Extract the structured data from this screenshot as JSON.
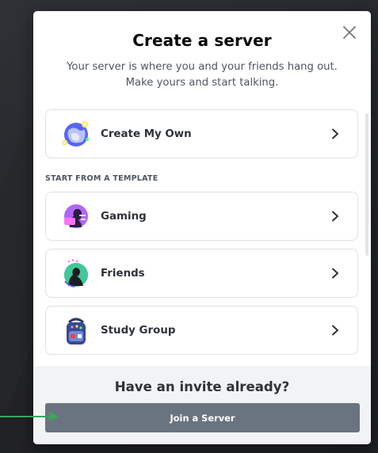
{
  "modal": {
    "title": "Create a server",
    "subtitle": "Your server is where you and your friends hang out. Make yours and start talking.",
    "close_icon": "close-icon"
  },
  "options": {
    "create_own": {
      "label": "Create My Own",
      "icon": "create-server-globe-icon"
    },
    "section_header": "START FROM A TEMPLATE",
    "templates": [
      {
        "label": "Gaming",
        "icon": "gaming-template-icon"
      },
      {
        "label": "Friends",
        "icon": "friends-template-icon"
      },
      {
        "label": "Study Group",
        "icon": "study-group-template-icon"
      }
    ]
  },
  "footer": {
    "title": "Have an invite already?",
    "join_button": "Join a Server"
  },
  "colors": {
    "modal_bg": "#ffffff",
    "footer_bg": "#f2f3f5",
    "button_bg": "#6a7480",
    "annotation_arrow": "#3ba55c"
  }
}
